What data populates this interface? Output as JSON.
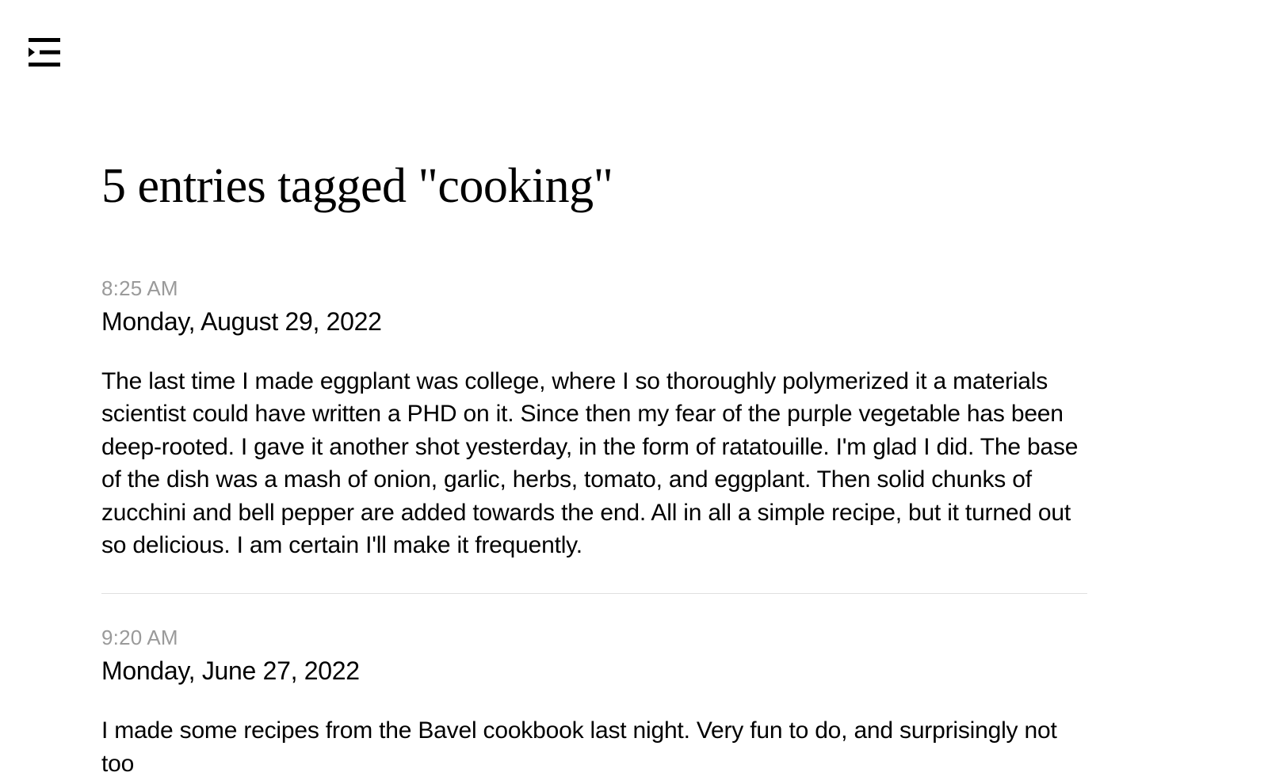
{
  "header": {
    "title": "5 entries tagged \"cooking\""
  },
  "entries": [
    {
      "time": "8:25 AM",
      "date": "Monday, August 29, 2022",
      "body": "The last time I made eggplant was college, where I so thoroughly polymerized it a materials scientist could have written a PHD on it. Since then my fear of the purple vegetable has been deep-rooted. I gave it another shot yesterday, in the form of ratatouille. I'm glad I did. The base of the dish was a mash of onion, garlic, herbs, tomato, and eggplant. Then solid chunks of zucchini and bell pepper are added towards the end. All in all a simple recipe, but it turned out so delicious. I am certain I'll make it frequently."
    },
    {
      "time": "9:20 AM",
      "date": "Monday, June 27, 2022",
      "body": "I made some recipes from the Bavel cookbook last night. Very fun to do, and surprisingly not too"
    }
  ]
}
